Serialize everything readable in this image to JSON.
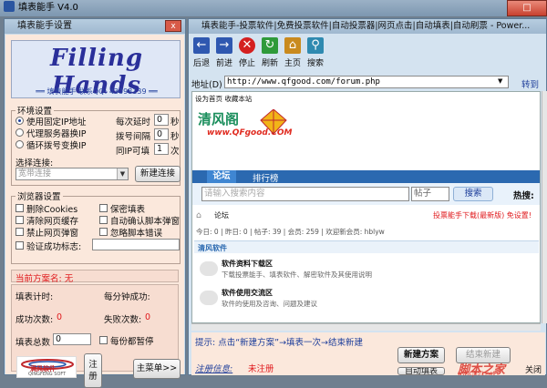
{
  "app": {
    "title": "填表能手 V4.0",
    "max": "□"
  },
  "left": {
    "title": "填表能手设置",
    "close": "x",
    "logo": {
      "big": "Filling Hands",
      "sub": "══ 填表能手 联系QQ: 43098139 ══"
    },
    "ip": {
      "legend": "环境设置",
      "opt1": "使用固定IP地址",
      "opt2": "代理服务器换IP",
      "opt3": "循环拨号变换IP",
      "delay_label": "每次延时",
      "delay_val": "0",
      "delay_unit": "秒",
      "dial_label": "拨号间隔",
      "dial_val": "0",
      "dial_unit": "秒",
      "same_label": "同IP可填",
      "same_val": "1",
      "same_unit": "次",
      "connect_label": "选择连接:",
      "connect_val": "宽带连接",
      "connect_btn": "新建连接"
    },
    "browser": {
      "legend": "浏览器设置",
      "c1": "删除Cookies",
      "c2": "保密填表",
      "c3": "清除网页缓存",
      "c4": "自动确认脚本弹窗",
      "c5": "禁止网页弹窗",
      "c6": "忽略脚本错误",
      "c7": "验证成功标志:"
    },
    "plan": "当前方案名: 无",
    "stats": {
      "time": "填表计时:",
      "per_min": "每分钟成功:",
      "ok": "成功次数:",
      "ok_val": "0",
      "fail": "失败次数:",
      "fail_val": "0",
      "total": "填表总数",
      "total_val": "0",
      "pause": "每份都暂停"
    },
    "brand": {
      "name": "满风软件",
      "en": "QINGFENG SOFT"
    },
    "reg_btn": "注册",
    "menu_btn": "主菜单>>"
  },
  "right": {
    "title": "填表能手-投票软件|免费投票软件|自动投票器|网页点击|自动填表|自动刷票 - Power...",
    "tools": [
      "后退",
      "前进",
      "停止",
      "刷新",
      "主页",
      "搜索"
    ],
    "addr_label": "地址(D)",
    "url": "http://www.qfgood.com/forum.php",
    "go": "转到",
    "page": {
      "top_links": "设为首页  收藏本站",
      "site_logo": "清风阁",
      "site_url": "www.QFgood.COM",
      "nav": [
        "论坛",
        "排行榜"
      ],
      "search_ph": "请输入搜索内容",
      "search_sel": "帖子",
      "search_btn": "搜索",
      "hot": "热搜:",
      "crumb": "论坛",
      "promo": "投票能手下载(最新版) 免设置!",
      "stats": "今日: 0 | 昨日: 0 | 帖子: 39 | 会员: 259 | 欢迎新会员: hblyw",
      "section": "清风软件",
      "f1_title": "软件资料下载区",
      "f1_desc": "下载投票能手、填表软件、解密软件及其使用说明",
      "f2_title": "软件使用交流区",
      "f2_desc": "软件的使用及咨询、问题及建议"
    },
    "hint": "提示: 点击“新建方案”→填表一次→结束新建",
    "new_plan": "新建方案",
    "end_new": "结束新建",
    "reg_info_label": "注册信息:",
    "reg_info": "未注册",
    "auto_fill": "自动填表",
    "watermark": "脚本之家",
    "watermark_url": "www.jb51.net",
    "exit": "关闭"
  }
}
